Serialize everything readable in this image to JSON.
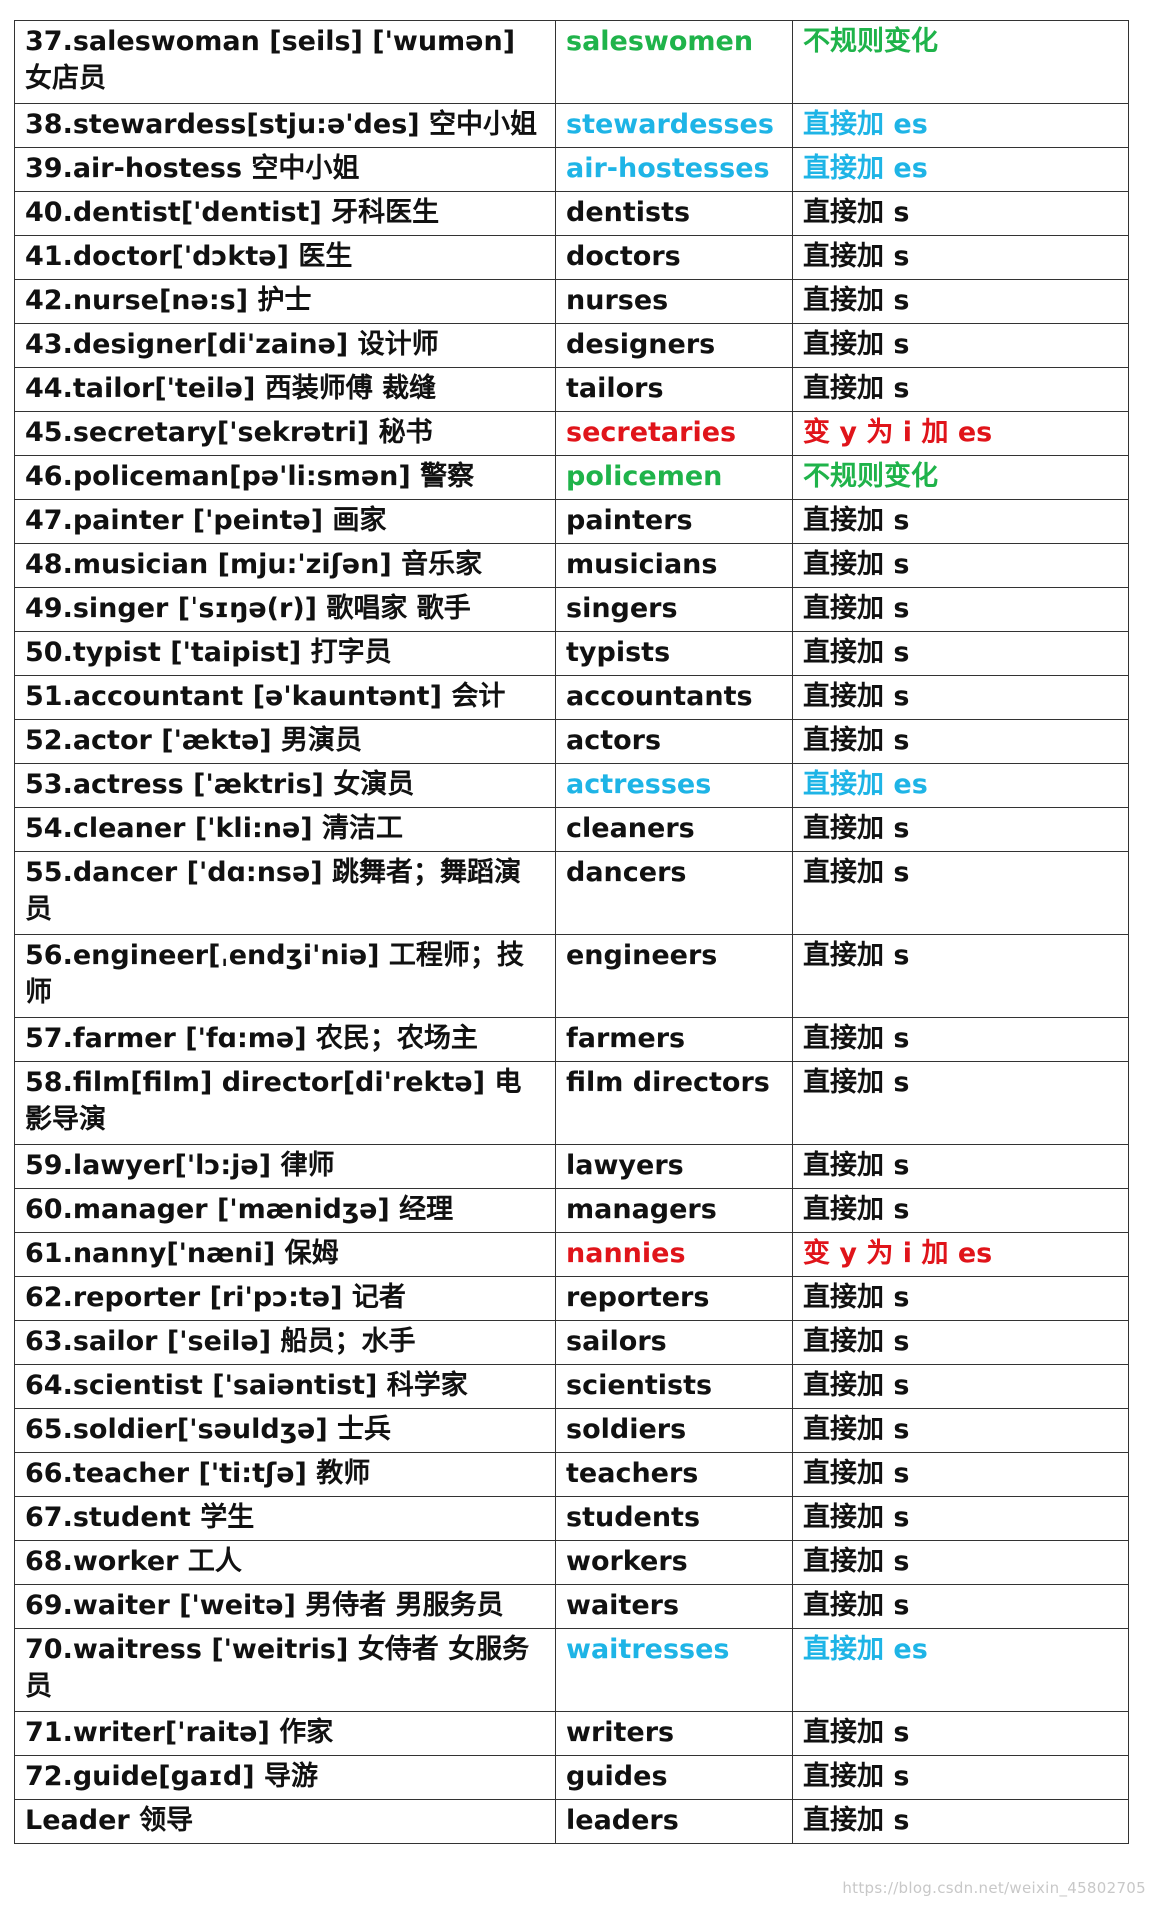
{
  "colors": {
    "default": "#111111",
    "blue": "#1eb4e6",
    "green": "#1fb34a",
    "red": "#e0141a"
  },
  "rows": [
    {
      "word": "37.saleswoman [seils] ['wumən] 女店员",
      "plural": "saleswomen",
      "rule": "不规则变化",
      "color": "green",
      "h": 83
    },
    {
      "word": "38.stewardess[stju:ə'des] 空中小姐",
      "plural": "stewardesses",
      "rule": "直接加 es",
      "color": "blue",
      "h": 42
    },
    {
      "word": "39.air-hostess 空中小姐",
      "plural": "air-hostesses",
      "rule": "直接加 es",
      "color": "blue",
      "h": 42
    },
    {
      "word": "40.dentist['dentist] 牙科医生",
      "plural": "dentists",
      "rule": "直接加 s",
      "color": "black",
      "h": 42
    },
    {
      "word": "41.doctor['dɔktə] 医生",
      "plural": "doctors",
      "rule": "直接加 s",
      "color": "black",
      "h": 42
    },
    {
      "word": "42.nurse[nə:s] 护士",
      "plural": "nurses",
      "rule": "直接加 s",
      "color": "black",
      "h": 42
    },
    {
      "word": "43.designer[di'zainə] 设计师",
      "plural": "designers",
      "rule": "直接加 s",
      "color": "black",
      "h": 42
    },
    {
      "word": "44.tailor['teilə] 西装师傅 裁缝",
      "plural": "tailors",
      "rule": "直接加 s",
      "color": "black",
      "h": 42
    },
    {
      "word": "45.secretary['sekrətri] 秘书",
      "plural": "secretaries",
      "rule": "变 y 为 i 加 es",
      "color": "red",
      "h": 42
    },
    {
      "word": "46.policeman[pə'li:smən] 警察",
      "plural": "policemen",
      "rule": "不规则变化",
      "color": "green",
      "h": 42
    },
    {
      "word": "47.painter ['peintə] 画家",
      "plural": "painters",
      "rule": "直接加 s",
      "color": "black",
      "h": 42
    },
    {
      "word": "48.musician [mju:'ziʃən] 音乐家",
      "plural": "musicians",
      "rule": "直接加 s",
      "color": "black",
      "h": 42
    },
    {
      "word": "49.singer [ˈsɪŋə(r)] 歌唱家 歌手",
      "plural": "singers",
      "rule": "直接加 s",
      "color": "black",
      "h": 42
    },
    {
      "word": "50.typist ['taipist] 打字员",
      "plural": "typists",
      "rule": "直接加 s",
      "color": "black",
      "h": 42
    },
    {
      "word": "51.accountant [ə'kauntənt] 会计",
      "plural": "accountants",
      "rule": "直接加 s",
      "color": "black",
      "h": 42
    },
    {
      "word": "52.actor ['æktə] 男演员",
      "plural": "actors",
      "rule": "直接加 s",
      "color": "black",
      "h": 42
    },
    {
      "word": "53.actress ['æktris] 女演员",
      "plural": "actresses",
      "rule": "直接加 es",
      "color": "blue",
      "h": 42
    },
    {
      "word": "54.cleaner ['kli:nə] 清洁工",
      "plural": "cleaners",
      "rule": "直接加 s",
      "color": "black",
      "h": 42
    },
    {
      "word": "55.dancer ['dɑ:nsə] 跳舞者；舞蹈演员",
      "plural": "dancers",
      "rule": "直接加 s",
      "color": "black",
      "h": 83
    },
    {
      "word": "56.engineer[ˌendʒi'niə] 工程师；技师",
      "plural": "engineers",
      "rule": "直接加 s",
      "color": "black",
      "h": 83
    },
    {
      "word": "57.farmer ['fɑ:mə] 农民；农场主",
      "plural": "farmers",
      "rule": "直接加 s",
      "color": "black",
      "h": 42
    },
    {
      "word": "58.film[film] director[di'rektə] 电影导演",
      "plural": "film directors",
      "rule": "直接加 s",
      "color": "black",
      "h": 83
    },
    {
      "word": "59.lawyer['lɔ:jə] 律师",
      "plural": "lawyers",
      "rule": "直接加 s",
      "color": "black",
      "h": 42
    },
    {
      "word": "60.manager ['mænidʒə] 经理",
      "plural": "managers",
      "rule": "直接加 s",
      "color": "black",
      "h": 42
    },
    {
      "word": "61.nanny['næni] 保姆",
      "plural": "nannies",
      "rule": "变 y 为 i 加 es",
      "color": "red",
      "h": 42
    },
    {
      "word": "62.reporter [ri'pɔ:tə] 记者",
      "plural": "reporters",
      "rule": "直接加 s",
      "color": "black",
      "h": 42
    },
    {
      "word": "63.sailor ['seilə] 船员；水手",
      "plural": "sailors",
      "rule": "直接加 s",
      "color": "black",
      "h": 42
    },
    {
      "word": "64.scientist ['saiəntist] 科学家",
      "plural": "scientists",
      "rule": "直接加 s",
      "color": "black",
      "h": 42
    },
    {
      "word": "65.soldier['səuldʒə] 士兵",
      "plural": "soldiers",
      "rule": "直接加 s",
      "color": "black",
      "h": 42
    },
    {
      "word": "66.teacher ['ti:tʃə] 教师",
      "plural": "teachers",
      "rule": "直接加 s",
      "color": "black",
      "h": 42
    },
    {
      "word": "67.student 学生",
      "plural": "students",
      "rule": "直接加 s",
      "color": "black",
      "h": 42
    },
    {
      "word": "68.worker 工人",
      "plural": "workers",
      "rule": "直接加 s",
      "color": "black",
      "h": 42
    },
    {
      "word": "69.waiter ['weitə] 男侍者 男服务员",
      "plural": "waiters",
      "rule": "直接加 s",
      "color": "black",
      "h": 42
    },
    {
      "word": "70.waitress ['weitris] 女侍者 女服务员",
      "plural": "waitresses",
      "rule": "直接加 es",
      "color": "blue",
      "h": 83
    },
    {
      "word": "71.writer['raitə] 作家",
      "plural": "writers",
      "rule": "直接加 s",
      "color": "black",
      "h": 42
    },
    {
      "word": "72.guide[gaɪd] 导游",
      "plural": "guides",
      "rule": "直接加 s",
      "color": "black",
      "h": 42
    },
    {
      "word": "Leader 领导",
      "plural": "leaders",
      "rule": "直接加 s",
      "color": "black",
      "h": 42
    }
  ],
  "watermark": "https://blog.csdn.net/weixin_45802705"
}
